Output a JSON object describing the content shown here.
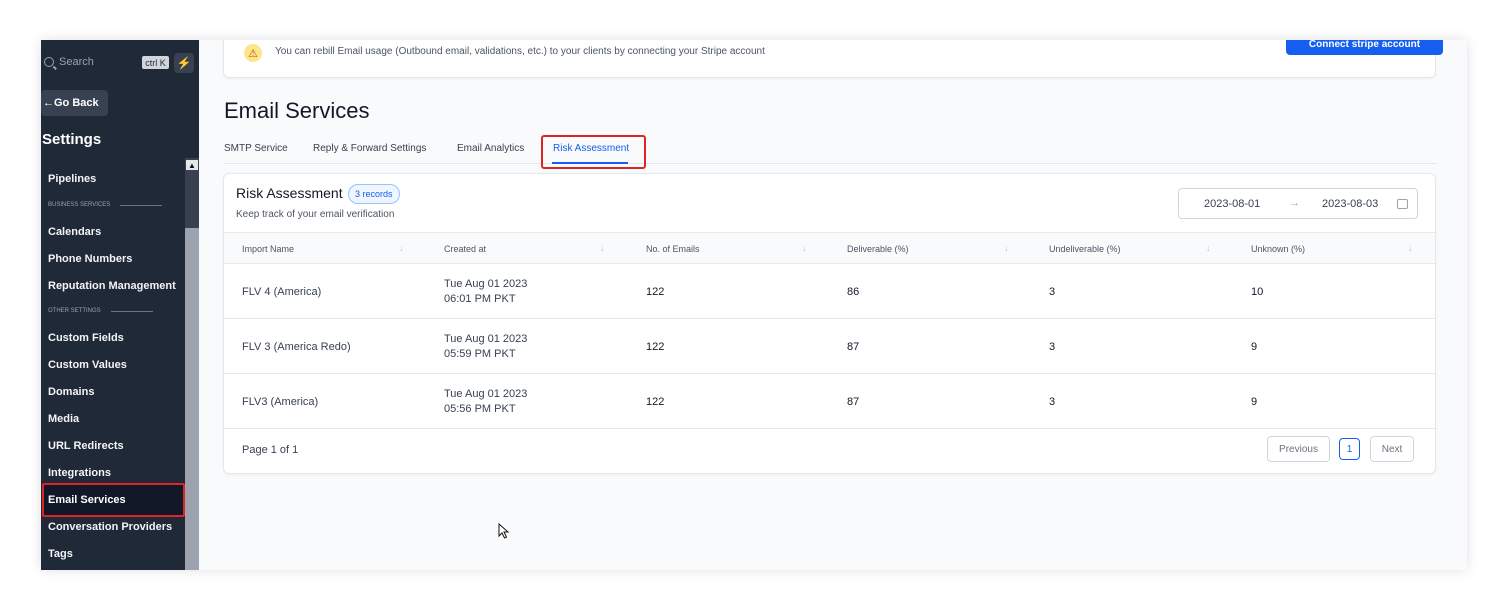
{
  "sidebar": {
    "search_placeholder": "Search",
    "search_shortcut": "ctrl K",
    "go_back": "Go Back",
    "title": "Settings",
    "items": [
      {
        "label": "Pipelines"
      },
      {
        "section": "BUSINESS SERVICES"
      },
      {
        "label": "Calendars"
      },
      {
        "label": "Phone Numbers"
      },
      {
        "label": "Reputation Management"
      },
      {
        "section": "OTHER SETTINGS"
      },
      {
        "label": "Custom Fields"
      },
      {
        "label": "Custom Values"
      },
      {
        "label": "Domains"
      },
      {
        "label": "Media"
      },
      {
        "label": "URL Redirects"
      },
      {
        "label": "Integrations"
      },
      {
        "label": "Email Services",
        "active": true
      },
      {
        "label": "Conversation Providers"
      },
      {
        "label": "Tags"
      }
    ]
  },
  "banner": {
    "message": "You can rebill Email usage (Outbound email, validations, etc.) to your clients by connecting your Stripe account",
    "button": "Connect stripe account"
  },
  "page": {
    "title": "Email Services",
    "tabs": [
      {
        "label": "SMTP Service",
        "active": false
      },
      {
        "label": "Reply & Forward Settings",
        "active": false
      },
      {
        "label": "Email Analytics",
        "active": false
      },
      {
        "label": "Risk Assessment",
        "active": true
      }
    ]
  },
  "card": {
    "title": "Risk Assessment",
    "badge": "3 records",
    "subtitle": "Keep track of your email verification",
    "date_from": "2023-08-01",
    "date_to": "2023-08-03",
    "columns": [
      "Import Name",
      "Created at",
      "No. of Emails",
      "Deliverable (%)",
      "Undeliverable (%)",
      "Unknown (%)"
    ],
    "rows": [
      {
        "name": "FLV 4 (America)",
        "date": "Tue Aug 01 2023",
        "time": "06:01 PM PKT",
        "emails": "122",
        "deliverable": "86",
        "undeliverable": "3",
        "unknown": "10"
      },
      {
        "name": "FLV 3 (America Redo)",
        "date": "Tue Aug 01 2023",
        "time": "05:59 PM PKT",
        "emails": "122",
        "deliverable": "87",
        "undeliverable": "3",
        "unknown": "9"
      },
      {
        "name": "FLV3 (America)",
        "date": "Tue Aug 01 2023",
        "time": "05:56 PM PKT",
        "emails": "122",
        "deliverable": "87",
        "undeliverable": "3",
        "unknown": "9"
      }
    ],
    "pagination": {
      "label": "Page 1 of 1",
      "previous": "Previous",
      "current": "1",
      "next": "Next"
    }
  },
  "colors": {
    "accent": "#155eef",
    "sidebar_bg": "#1f2937",
    "highlight": "#dc2626"
  }
}
